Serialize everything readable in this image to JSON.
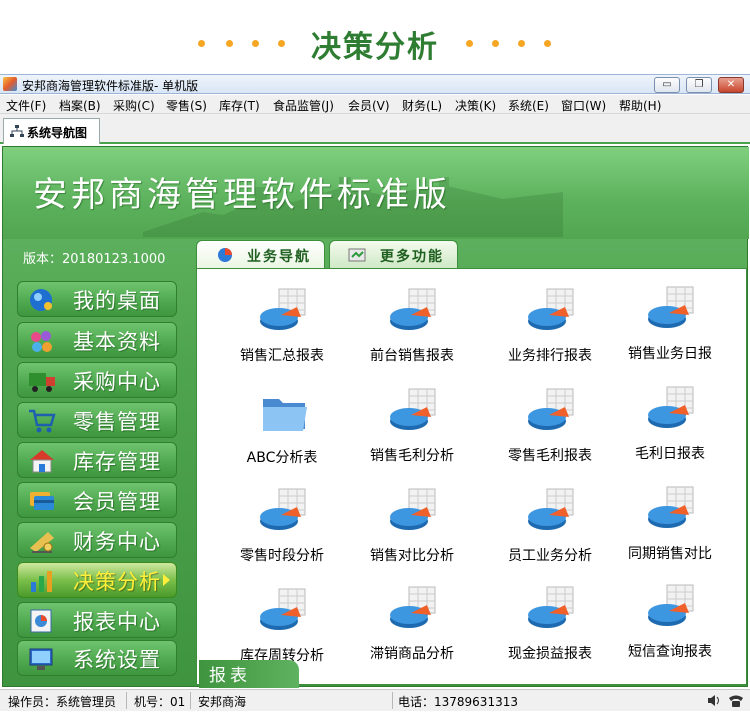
{
  "banner": {
    "title": "决策分析"
  },
  "window": {
    "title": "安邦商海管理软件标准版- 单机版",
    "controls": {
      "minimize": "▭",
      "restore": "❐",
      "close": "✕"
    }
  },
  "menu": [
    "文件(F)",
    "档案(B)",
    "采购(C)",
    "零售(S)",
    "库存(T)",
    "食品监管(J)",
    "会员(V)",
    "财务(L)",
    "决策(K)",
    "系统(E)",
    "窗口(W)",
    "帮助(H)"
  ],
  "doc_tab": {
    "label": "系统导航图"
  },
  "header": {
    "app_name": "安邦商海管理软件标准版"
  },
  "version": "版本：20180123.1000",
  "sidebar": {
    "items": [
      {
        "label": "我的桌面",
        "icon": "desktop-icon"
      },
      {
        "label": "基本资料",
        "icon": "cubes-icon"
      },
      {
        "label": "采购中心",
        "icon": "truck-icon"
      },
      {
        "label": "零售管理",
        "icon": "cart-icon"
      },
      {
        "label": "库存管理",
        "icon": "warehouse-icon"
      },
      {
        "label": "会员管理",
        "icon": "member-card-icon"
      },
      {
        "label": "财务中心",
        "icon": "finance-icon"
      },
      {
        "label": "决策分析",
        "icon": "chart-bars-icon",
        "active": true
      },
      {
        "label": "报表中心",
        "icon": "report-icon"
      },
      {
        "label": "系统设置",
        "icon": "system-settings-icon"
      }
    ]
  },
  "feature_tabs": [
    {
      "label": "业务导航",
      "icon": "business-nav-icon",
      "active": true
    },
    {
      "label": "更多功能",
      "icon": "more-functions-icon",
      "active": false
    }
  ],
  "grid": [
    {
      "label": "销售汇总报表",
      "icon": "pie-report-icon"
    },
    {
      "label": "前台销售报表",
      "icon": "pie-report-icon"
    },
    {
      "label": "业务排行报表",
      "icon": "pie-report-icon"
    },
    {
      "label": "销售业务日报",
      "icon": "pie-report-icon"
    },
    {
      "label": "ABC分析表",
      "icon": "folder-icon"
    },
    {
      "label": "销售毛利分析",
      "icon": "pie-report-icon"
    },
    {
      "label": "零售毛利报表",
      "icon": "pie-report-icon"
    },
    {
      "label": "毛利日报表",
      "icon": "pie-report-icon"
    },
    {
      "label": "零售时段分析",
      "icon": "pie-report-icon"
    },
    {
      "label": "销售对比分析",
      "icon": "pie-report-icon"
    },
    {
      "label": "员工业务分析",
      "icon": "pie-report-icon"
    },
    {
      "label": "同期销售对比",
      "icon": "pie-report-icon"
    },
    {
      "label": "库存周转分析",
      "icon": "pie-report-icon"
    },
    {
      "label": "滞销商品分析",
      "icon": "pie-report-icon"
    },
    {
      "label": "现金损益报表",
      "icon": "pie-report-icon"
    },
    {
      "label": "短信查询报表",
      "icon": "pie-report-icon"
    }
  ],
  "report_tag": "报表",
  "status": {
    "operator": "操作员：系统管理员",
    "machine": "机号：01",
    "company": "安邦商海",
    "phone": "电话：13789631313"
  },
  "colors": {
    "accent_green": "#4fa44f",
    "active_label": "#ffef3a",
    "banner_title": "#2e7d32",
    "dot": "#f5a623"
  }
}
